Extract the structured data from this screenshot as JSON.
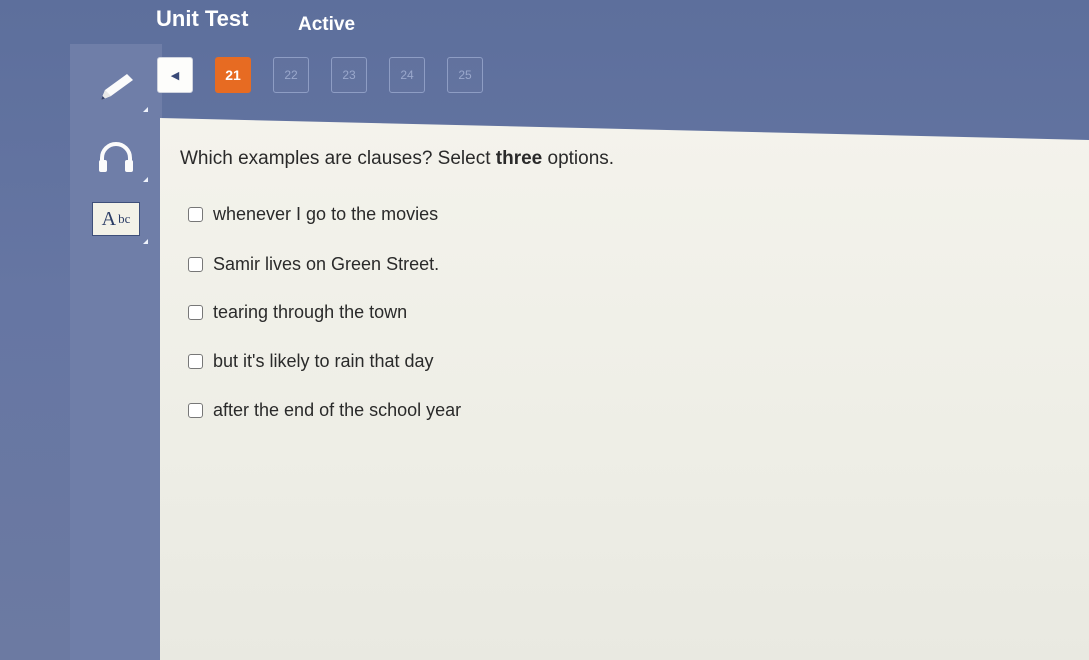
{
  "header": {
    "title": "Unit Test",
    "status": "Active"
  },
  "sidebar": {
    "tools": [
      {
        "name": "pencil-tool",
        "icon": "pencil-icon"
      },
      {
        "name": "audio-tool",
        "icon": "headphones-icon"
      },
      {
        "name": "dictionary-tool",
        "icon": "abc-icon",
        "label_big": "A",
        "label_small": "bc"
      }
    ]
  },
  "nav": {
    "back_symbol": "◀",
    "current": "21",
    "pages": [
      "22",
      "23",
      "24",
      "25"
    ]
  },
  "question": {
    "prefix": "Which examples are clauses? Select ",
    "emphasis": "three",
    "suffix": " options."
  },
  "options": [
    "whenever I go to the movies",
    "Samir lives on Green Street.",
    "tearing through the town",
    "but it's likely to rain that day",
    "after the end of the school year"
  ],
  "colors": {
    "accent": "#e76b22",
    "background": "#6676a3",
    "panel": "#f1f0e9"
  }
}
